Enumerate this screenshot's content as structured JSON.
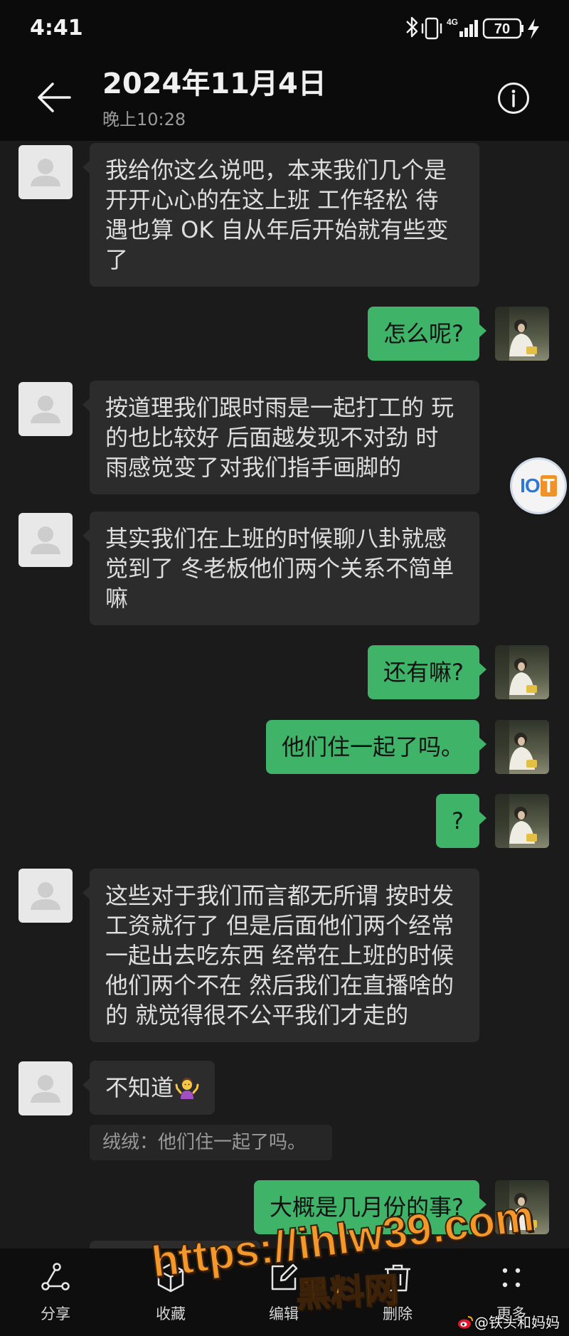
{
  "status_bar": {
    "time": "4:41",
    "network": "4G",
    "battery": "70"
  },
  "header": {
    "title": "2024年11月4日",
    "subtitle": "晚上10:28",
    "back_icon": "back-arrow-icon",
    "info_icon": "info-icon"
  },
  "colors": {
    "sent_bubble": "#3fb469",
    "received_bubble": "#2c2c2c",
    "watermark": "#f5982c"
  },
  "messages": [
    {
      "sent": false,
      "avatar": "default-avatar-icon",
      "lines": [
        "我给你这么说吧，本来我们几个是",
        "开开心心的在这上班 工作轻松 待",
        "遇也算 OK 自从年后开始就有些变",
        "了"
      ]
    },
    {
      "sent": true,
      "avatar": "photo-avatar",
      "lines": [
        "怎么呢?"
      ]
    },
    {
      "sent": false,
      "avatar": "default-avatar-icon",
      "lines": [
        "按道理我们跟时雨是一起打工的 玩",
        "的也比较好 后面越发现不对劲 时",
        "雨感觉变了对我们指手画脚的"
      ]
    },
    {
      "sent": false,
      "avatar": "default-avatar-icon",
      "lines": [
        "其实我们在上班的时候聊八卦就感",
        "觉到了 冬老板他们两个关系不简单",
        "嘛"
      ]
    },
    {
      "sent": true,
      "avatar": "photo-avatar",
      "lines": [
        "还有嘛?"
      ]
    },
    {
      "sent": true,
      "avatar": "photo-avatar",
      "lines": [
        "他们住一起了吗。"
      ]
    },
    {
      "sent": true,
      "avatar": "photo-avatar",
      "lines": [
        "?"
      ]
    },
    {
      "sent": false,
      "avatar": "default-avatar-icon",
      "lines": [
        "这些对于我们而言都无所谓 按时发",
        "工资就行了 但是后面他们两个经常",
        "一起出去吃东西 经常在上班的时候",
        "他们两个不在 然后我们在直播啥的",
        "的 就觉得很不公平我们才走的"
      ]
    },
    {
      "sent": false,
      "avatar": "default-avatar-icon",
      "lines": [
        "不知道"
      ],
      "emoji": "person-shrugging-icon",
      "quote": "绒绒：他们住一起了吗。"
    },
    {
      "sent": true,
      "avatar": "photo-avatar",
      "lines": [
        "大概是几月份的事?"
      ]
    }
  ],
  "floating_badge": {
    "text_a": "IO",
    "text_b": "T"
  },
  "toolbar": [
    {
      "label": "分享",
      "icon": "share-icon"
    },
    {
      "label": "收藏",
      "icon": "favorites-cube-icon"
    },
    {
      "label": "编辑",
      "icon": "edit-icon"
    },
    {
      "label": "删除",
      "icon": "delete-icon"
    },
    {
      "label": "更多",
      "icon": "more-icon"
    }
  ],
  "watermark": {
    "url": "https://ihlw39.com",
    "site": "黑料网",
    "weibo": "@铁头和妈妈",
    "weibo_icon": "weibo-icon"
  }
}
